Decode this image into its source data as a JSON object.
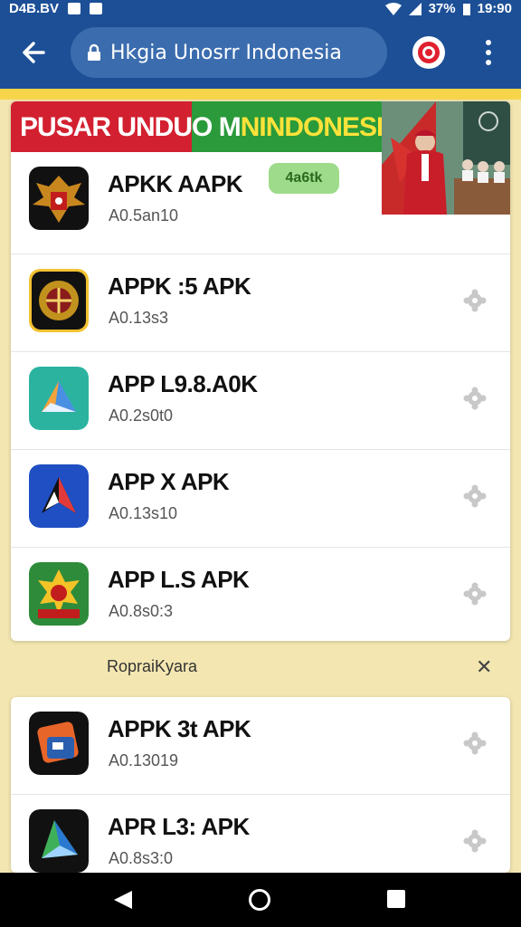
{
  "status": {
    "left": "D4B.BV",
    "battery": "37%",
    "time": "19:90"
  },
  "browser": {
    "url_title": "Hkgia Unosrr Indonesia",
    "icons": [
      "back-arrow-icon",
      "lock-icon",
      "target-icon",
      "more-vert-icon"
    ]
  },
  "banner": {
    "title_red": "PUSAR UNDUO",
    "title_green": "NINDONESIA",
    "title_mid": "M"
  },
  "apps": [
    {
      "name": "APKK AAPK",
      "sub": "A0.5an10",
      "badge": "4a6tk"
    },
    {
      "name": "APPK :5 APK",
      "sub": "A0.13s3"
    },
    {
      "name": "APP L9.8.A0K",
      "sub": "A0.2s0t0"
    },
    {
      "name": "APP X APK",
      "sub": "A0.13s10"
    },
    {
      "name": "APP L.S APK",
      "sub": "A0.8s0:3"
    }
  ],
  "ad": {
    "label": "RopraiKyara",
    "close": "✕"
  },
  "apps2": [
    {
      "name": "APPK 3t APK",
      "sub": "A0.13019"
    },
    {
      "name": "APR L3: APK",
      "sub": "A0.8s3:0"
    }
  ],
  "colors": {
    "appbar": "#1c4f96",
    "background": "#f3e6b0",
    "accent_yellow": "#f6d54b"
  }
}
